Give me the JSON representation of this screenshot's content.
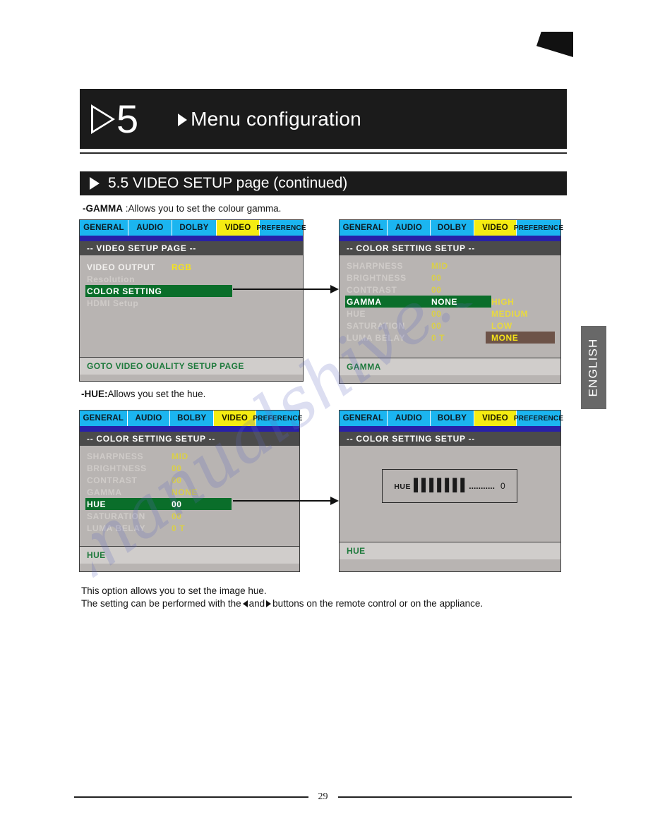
{
  "chapter": {
    "number": "5",
    "title": "Menu configuration"
  },
  "section": {
    "title": "5.5 VIDEO SETUP page (continued)"
  },
  "captions": {
    "gamma_bold": "-GAMMA",
    "gamma_rest": " :Allows you to set the colour gamma.",
    "hue_bold": "-HUE:",
    "hue_rest": "Allows you set the hue."
  },
  "colors": {
    "tab_blue": "#1bb5f0",
    "tab_active_yellow": "#f5ec12",
    "blue_bar": "#2820a8",
    "heading_gray": "#4b4b4b",
    "body_gray": "#b8b4b2",
    "footer_gray": "#d0cdcb",
    "highlight_green": "#0a6e2a",
    "value_yellow": "#f5e31a",
    "option_selected_brown": "#6d5348",
    "footer_text_green": "#1f7a3d",
    "banner_black": "#1b1b1b",
    "lang_tab_gray": "#686868"
  },
  "osd_panels": [
    {
      "id": "video-setup-page",
      "tabs": [
        {
          "label": "GENERAL",
          "active": false
        },
        {
          "label": "AUDIO",
          "active": false
        },
        {
          "label": "DOLBY",
          "active": false
        },
        {
          "label": "VIDEO",
          "active": true
        },
        {
          "label": "PREFERENCE",
          "active": false
        }
      ],
      "heading": "-- VIDEO SETUP PAGE --",
      "rows": [
        {
          "label": "VIDEO OUTPUT",
          "value": "RGB",
          "selected": false,
          "dim": false
        },
        {
          "label": "Resolution",
          "value": "",
          "selected": false,
          "dim": true
        },
        {
          "label": "COLOR SETTING",
          "value": "",
          "selected": true,
          "dim": false
        },
        {
          "label": "HDMI Setup",
          "value": "",
          "selected": false,
          "dim": true
        }
      ],
      "options": [],
      "footer": "GOTO VIDEO OUALITY SETUP PAGE"
    },
    {
      "id": "color-setting-setup-gamma",
      "tabs": [
        {
          "label": "GENERAL",
          "active": false
        },
        {
          "label": "AUDIO",
          "active": false
        },
        {
          "label": "DOLBY",
          "active": false
        },
        {
          "label": "VIDEO",
          "active": true
        },
        {
          "label": "PREFERENCE",
          "active": false
        }
      ],
      "heading": "-- COLOR SETTING SETUP --",
      "rows": [
        {
          "label": "SHARPNESS",
          "value": "MID",
          "selected": false,
          "dim": true
        },
        {
          "label": "BRIGHTNESS",
          "value": "00",
          "selected": false,
          "dim": true
        },
        {
          "label": "CONTRAST",
          "value": "00",
          "selected": false,
          "dim": true
        },
        {
          "label": "GAMMA",
          "value": "NONE",
          "selected": true,
          "dim": false
        },
        {
          "label": "HUE",
          "value": "00",
          "selected": false,
          "dim": true
        },
        {
          "label": "SATURATION",
          "value": "00",
          "selected": false,
          "dim": true
        },
        {
          "label": "LUMA BELAY",
          "value": "0 T",
          "selected": false,
          "dim": true
        }
      ],
      "options": [
        {
          "label": "HIGH",
          "selected": false
        },
        {
          "label": "MEDIUM",
          "selected": false
        },
        {
          "label": "LOW",
          "selected": false
        },
        {
          "label": "MONE",
          "selected": true
        }
      ],
      "footer": "GAMMA"
    },
    {
      "id": "color-setting-setup-hue",
      "tabs": [
        {
          "label": "GENERAL",
          "active": false
        },
        {
          "label": "AUDIO",
          "active": false
        },
        {
          "label": "BOLBY",
          "active": false
        },
        {
          "label": "VIDEO",
          "active": true
        },
        {
          "label": "PREFERENCE",
          "active": false
        }
      ],
      "heading": "-- COLOR SETTING SETUP --",
      "rows": [
        {
          "label": "SHARPNESS",
          "value": "MID",
          "selected": false,
          "dim": true
        },
        {
          "label": "BRIGHTNESS",
          "value": "00",
          "selected": false,
          "dim": true
        },
        {
          "label": "CONTRAST",
          "value": "00",
          "selected": false,
          "dim": true
        },
        {
          "label": "GAMMA",
          "value": "NONE",
          "selected": false,
          "dim": true
        },
        {
          "label": "HUE",
          "value": "00",
          "selected": true,
          "dim": false
        },
        {
          "label": "SATURATION",
          "value": "00",
          "selected": false,
          "dim": true
        },
        {
          "label": "LUMA BELAY",
          "value": "0 T",
          "selected": false,
          "dim": true
        }
      ],
      "options": [],
      "footer": "HUE"
    },
    {
      "id": "hue-slider-popup",
      "tabs": [
        {
          "label": "GENERAL",
          "active": false
        },
        {
          "label": "AUDIO",
          "active": false
        },
        {
          "label": "BOLBY",
          "active": false
        },
        {
          "label": "VIDEO",
          "active": true
        },
        {
          "label": "PREFERENCE",
          "active": false
        }
      ],
      "heading": "-- COLOR SETTING SETUP --",
      "rows": [],
      "options": [],
      "footer": "HUE",
      "slider": {
        "label": "HUE",
        "bars": "▌▌▌▌▌▌▌",
        "dots": "...........",
        "value": "0"
      }
    }
  ],
  "lang_tab": {
    "label": "ENGLISH"
  },
  "body_text": {
    "line1": "This option allows you to set the image hue.",
    "line2_a": "The setting can be performed with the",
    "line2_b": "and",
    "line2_c": "buttons on the remote control or on the appliance."
  },
  "footer": {
    "page_number": "29"
  },
  "watermark": {
    "text": "manualshive.com"
  }
}
